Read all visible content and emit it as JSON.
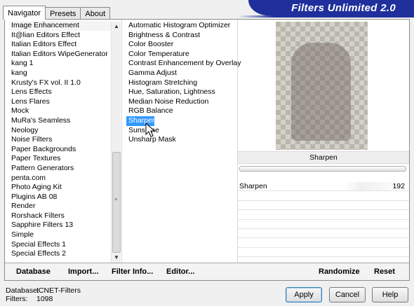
{
  "tabs": [
    "Navigator",
    "Presets",
    "About"
  ],
  "banner_title": "Filters Unlimited 2.0",
  "categories": {
    "items": [
      "Image Enhancement",
      "It@lian Editors Effect",
      "Italian Editors Effect",
      "Italian Editors WipeGenerator",
      "kang 1",
      "kang",
      "Krusty's FX vol. II 1.0",
      "Lens Effects",
      "Lens Flares",
      "Mock",
      "MuRa's Seamless",
      "Neology",
      "Noise Filters",
      "Paper Backgrounds",
      "Paper Textures",
      "Pattern Generators",
      "penta.com",
      "Photo Aging Kit",
      "Plugins AB 08",
      "Render",
      "Rorshack Filters",
      "Sapphire Filters 13",
      "Simple",
      "Special Effects 1",
      "Special Effects 2"
    ],
    "selected": "Image Enhancement"
  },
  "filters": {
    "items": [
      "Automatic Histogram Optimizer",
      "Brightness & Contrast",
      "Color Booster",
      "Color Temperature",
      "Contrast Enhancement by Overlay",
      "Gamma Adjust",
      "Histogram Stretching",
      "Hue, Saturation, Lightness",
      "Median Noise Reduction",
      "RGB Balance",
      "Sharpen",
      "Sunshine",
      "Unsharp Mask"
    ],
    "selected": "Sharpen"
  },
  "bottom_left": {
    "database": "Database",
    "import": "Import...",
    "filter_info": "Filter Info...",
    "editor": "Editor..."
  },
  "preview": {
    "filter_name": "Sharpen"
  },
  "params": [
    {
      "name": "Sharpen",
      "value": "192"
    }
  ],
  "bottom_right": {
    "randomize": "Randomize",
    "reset": "Reset"
  },
  "status": {
    "database_label": "Database:",
    "database_value": "ICNET-Filters",
    "filters_label": "Filters:",
    "filters_value": "1098"
  },
  "buttons": {
    "apply": "Apply",
    "cancel": "Cancel",
    "help": "Help"
  }
}
